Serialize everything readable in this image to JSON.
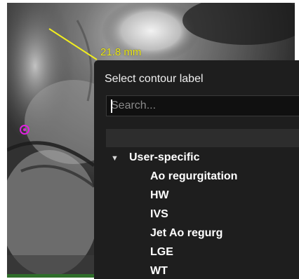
{
  "viewer": {
    "measurement_label": "21.8 mm",
    "annotation_color": "#f2ee1e",
    "point_marker_color": "#e020e0"
  },
  "dialog": {
    "title": "Select contour label",
    "search": {
      "value": "",
      "placeholder": "Search..."
    },
    "groups": [
      {
        "label": "User-specific",
        "expanded": true,
        "items": [
          {
            "label": "Ao regurgitation"
          },
          {
            "label": "HW"
          },
          {
            "label": "IVS"
          },
          {
            "label": "Jet Ao regurg"
          },
          {
            "label": "LGE"
          },
          {
            "label": "WT"
          }
        ]
      }
    ],
    "colors": {
      "background": "#1e1e1e",
      "text": "#ffffff"
    }
  }
}
